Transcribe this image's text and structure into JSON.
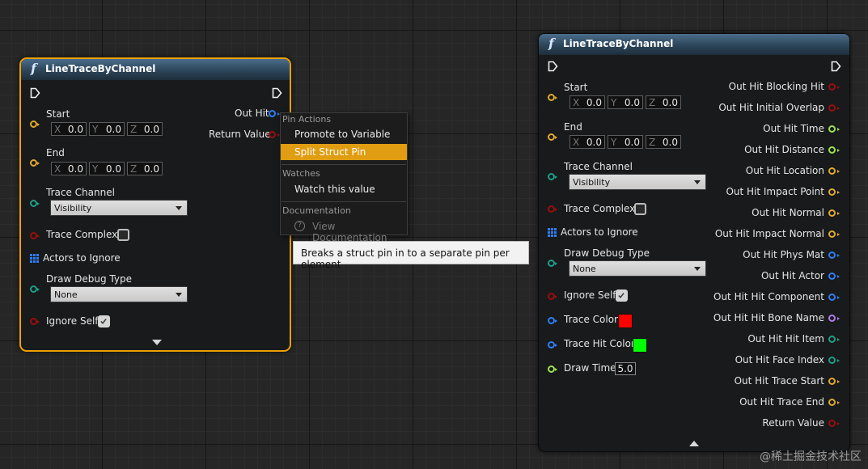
{
  "left_node": {
    "icon": "f",
    "title": "LineTraceByChannel",
    "start_label": "Start",
    "start": {
      "x": "0.0",
      "y": "0.0",
      "z": "0.0"
    },
    "end_label": "End",
    "end": {
      "x": "0.0",
      "y": "0.0",
      "z": "0.0"
    },
    "trace_channel_label": "Trace Channel",
    "trace_channel_value": "Visibility",
    "trace_complex_label": "Trace Complex",
    "actors_to_ignore_label": "Actors to Ignore",
    "draw_debug_type_label": "Draw Debug Type",
    "draw_debug_type_value": "None",
    "ignore_self_label": "Ignore Self",
    "out_hit_label": "Out Hit",
    "return_value_label": "Return Value"
  },
  "vector_axis_labels": {
    "x": "X",
    "y": "Y",
    "z": "Z"
  },
  "context_menu": {
    "pin_actions_header": "Pin Actions",
    "promote_to_variable": "Promote to Variable",
    "split_struct_pin": "Split Struct Pin",
    "watches_header": "Watches",
    "watch_this_value": "Watch this value",
    "documentation_header": "Documentation",
    "view_documentation": "View Documentation"
  },
  "tooltip": {
    "text": "Breaks a struct pin in to a separate pin per element"
  },
  "right_node": {
    "icon": "f",
    "title": "LineTraceByChannel",
    "start_label": "Start",
    "start": {
      "x": "0.0",
      "y": "0.0",
      "z": "0.0"
    },
    "end_label": "End",
    "end": {
      "x": "0.0",
      "y": "0.0",
      "z": "0.0"
    },
    "trace_channel_label": "Trace Channel",
    "trace_channel_value": "Visibility",
    "trace_complex_label": "Trace Complex",
    "actors_to_ignore_label": "Actors to Ignore",
    "draw_debug_type_label": "Draw Debug Type",
    "draw_debug_type_value": "None",
    "ignore_self_label": "Ignore Self",
    "trace_color_label": "Trace Color",
    "trace_color": "#ff0000",
    "trace_hit_color_label": "Trace Hit Color",
    "trace_hit_color": "#00ff00",
    "draw_time_label": "Draw Time",
    "draw_time_value": "5.0",
    "outputs": [
      "Out Hit Blocking Hit",
      "Out Hit Initial Overlap",
      "Out Hit Time",
      "Out Hit Distance",
      "Out Hit Location",
      "Out Hit Impact Point",
      "Out Hit Normal",
      "Out Hit Impact Normal",
      "Out Hit Phys Mat",
      "Out Hit Actor",
      "Out Hit Hit Component",
      "Out Hit Hit Bone Name",
      "Out Hit Hit Item",
      "Out Hit Face Index",
      "Out Hit Trace Start",
      "Out Hit Trace End",
      "Return Value"
    ]
  },
  "watermark": "@稀土掘金技术社区"
}
